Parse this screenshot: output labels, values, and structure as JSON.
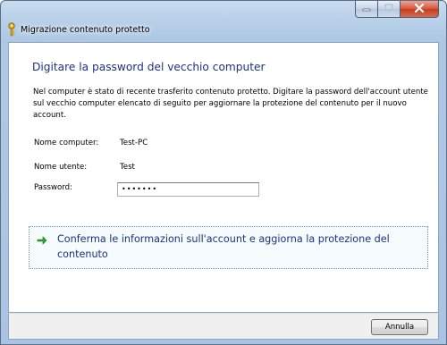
{
  "window": {
    "title": "Migrazione contenuto protetto"
  },
  "icons": {
    "app": "key-icon",
    "minimize": "minimize-icon",
    "maximize": "maximize-icon",
    "close": "close-icon",
    "command": "green-arrow-icon"
  },
  "colors": {
    "instruction": "#1e3287",
    "command_arrow": "#2da62d",
    "close_button": "#c63c1e"
  },
  "main": {
    "instruction": "Digitare la password del vecchio computer",
    "description": "Nel computer è stato di recente trasferito contenuto protetto. Digitare la password dell'account utente sul vecchio computer elencato di seguito per aggiornare la protezione del contenuto per il nuovo account.",
    "fields": {
      "computer_label": "Nome computer:",
      "computer_value": "Test-PC",
      "user_label": "Nome utente:",
      "user_value": "Test",
      "password_label": "Password:",
      "password_value": "•••••••"
    },
    "command_link": "Conferma le informazioni sull'account e aggiorna la protezione del contenuto"
  },
  "footer": {
    "cancel_label": "Annulla"
  }
}
